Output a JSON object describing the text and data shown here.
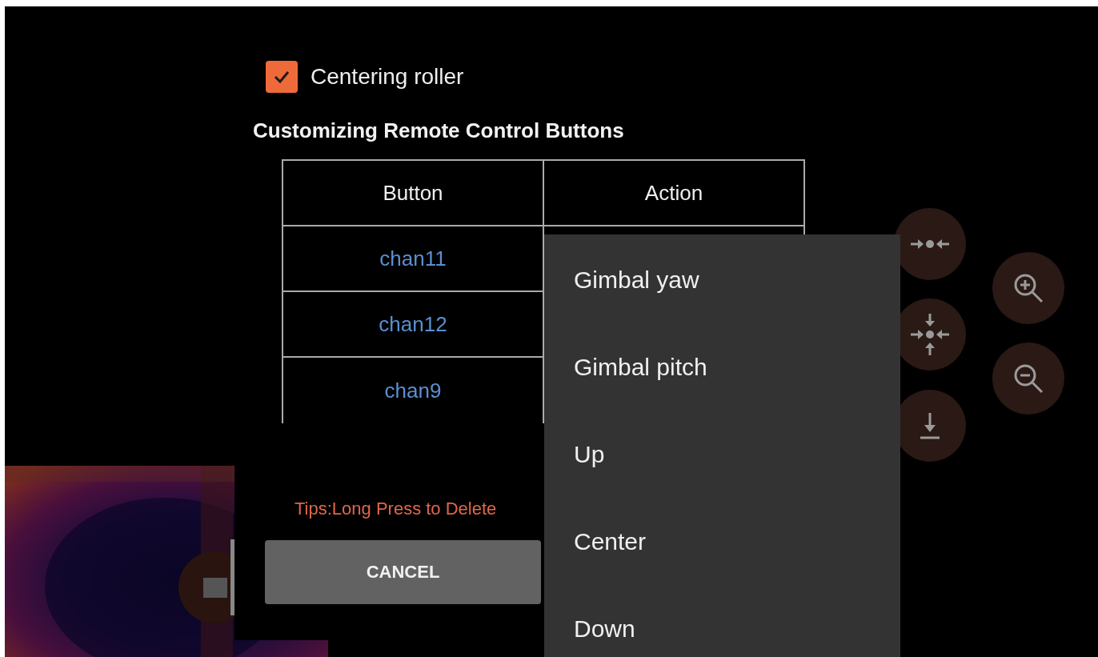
{
  "dialog": {
    "checkbox": {
      "label": "Centering roller",
      "checked": true
    },
    "title": "Customizing Remote Control Buttons",
    "table": {
      "columns": [
        "Button",
        "Action"
      ],
      "rows": [
        {
          "button": "chan11"
        },
        {
          "button": "chan12"
        },
        {
          "button": "chan9"
        }
      ]
    },
    "tip": "Tips:Long Press to Delete",
    "buttons": [
      "CANCEL"
    ]
  },
  "dropdown": {
    "items": [
      "Gimbal yaw",
      "Gimbal pitch",
      "Up",
      "Center",
      "Down"
    ]
  }
}
